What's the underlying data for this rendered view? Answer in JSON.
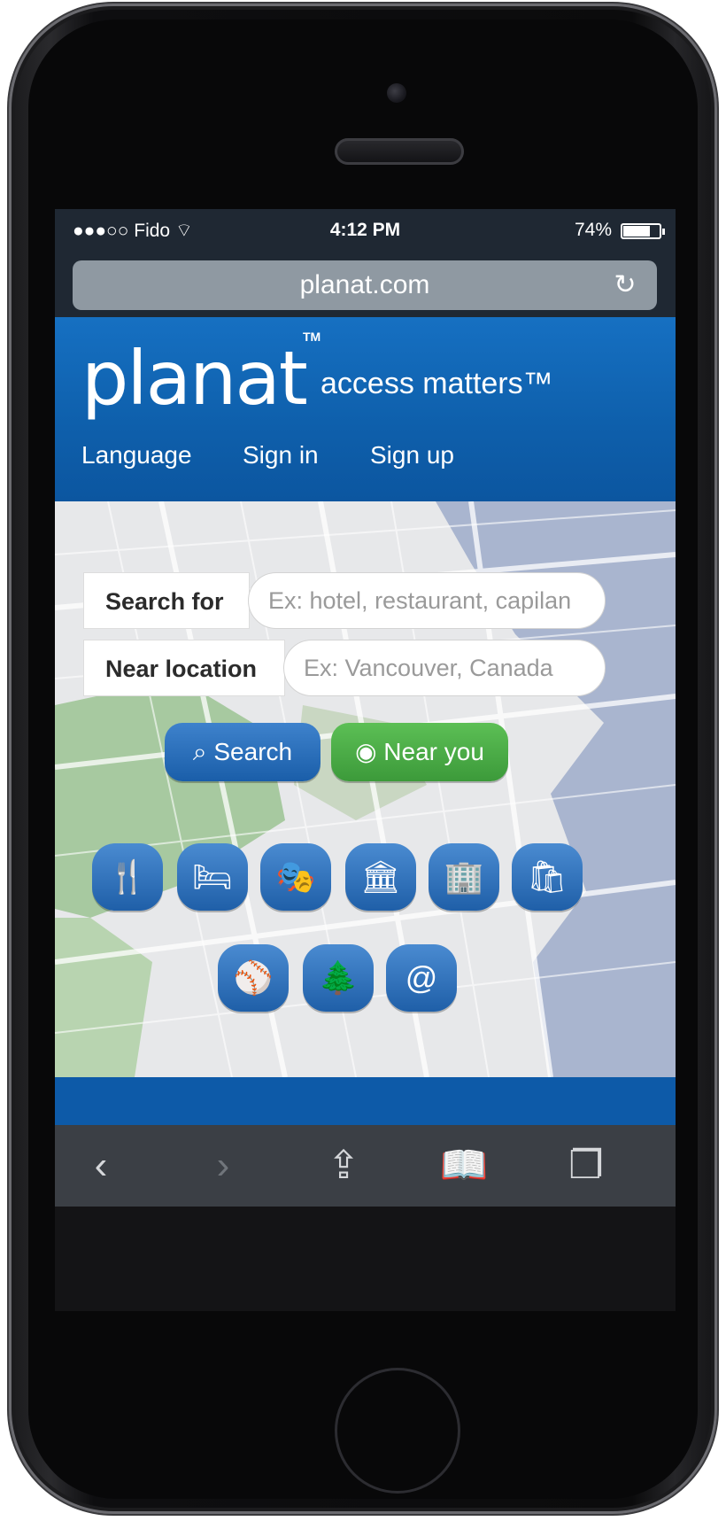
{
  "status_bar": {
    "carrier": "●●●○○ Fido ⌔",
    "time": "4:12 PM",
    "battery": "74%"
  },
  "browser": {
    "url": "planat.com",
    "reload_icon": "↻"
  },
  "site": {
    "logo": "planat",
    "logo_tm": "TM",
    "tagline": "access matters™",
    "nav": [
      "Language",
      "Sign in",
      "Sign up"
    ]
  },
  "search": {
    "search_for_label": "Search for",
    "search_for_placeholder": "Ex: hotel, restaurant, capilan",
    "near_location_label": "Near location",
    "near_location_placeholder": "Ex: Vancouver, Canada",
    "search_button": "Search",
    "near_you_button": "Near you"
  },
  "categories": [
    {
      "icon": "restaurant-icon",
      "glyph": "🍴"
    },
    {
      "icon": "hotel-icon",
      "glyph": "🛏"
    },
    {
      "icon": "theater-icon",
      "glyph": "🎭"
    },
    {
      "icon": "museum-icon",
      "glyph": "🏛"
    },
    {
      "icon": "building-icon",
      "glyph": "🏢"
    },
    {
      "icon": "shopping-icon",
      "glyph": "🛍"
    },
    {
      "icon": "sports-icon",
      "glyph": "⚾"
    },
    {
      "icon": "park-icon",
      "glyph": "🌲"
    },
    {
      "icon": "internet-icon",
      "glyph": "@"
    }
  ],
  "toolbar": {
    "back": "‹",
    "forward": "›",
    "share": "⇪",
    "bookmarks": "📖",
    "tabs": "❐"
  },
  "colors": {
    "header": "#0e5fab",
    "search_button": "#1a5ea9",
    "near_you_button": "#3c9a3a"
  }
}
